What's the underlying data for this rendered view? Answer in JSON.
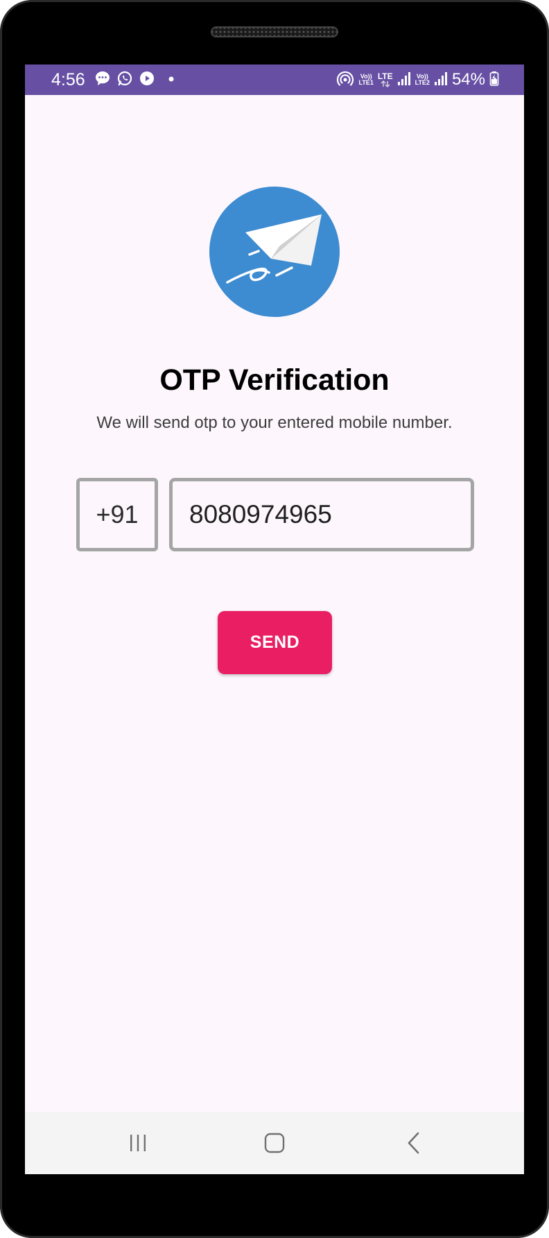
{
  "status_bar": {
    "time": "4:56",
    "battery": "54%",
    "sim1_top": "Vo))",
    "sim1_bottom": "LTE1",
    "lte_label": "LTE",
    "sim2_top": "Vo))",
    "sim2_bottom": "LTE2",
    "left_icons": [
      "chat-icon",
      "whatsapp-icon",
      "youtube-icon",
      "dot-icon"
    ],
    "right_icons": [
      "hotspot-icon",
      "signal-icon",
      "signal-icon",
      "battery-charging-icon"
    ]
  },
  "logo": {
    "icon": "paper-plane-icon",
    "circle_color": "#3d8bd0"
  },
  "page": {
    "title": "OTP Verification",
    "subtitle": "We will send otp to your entered mobile number."
  },
  "form": {
    "country_code": "+91",
    "phone_value": "8080974965",
    "send_label": "SEND"
  },
  "colors": {
    "status_bar": "#6750a4",
    "background": "#fdf7fd",
    "button": "#e91e63",
    "input_border": "#a5a5a5"
  },
  "nav_bar": {
    "icons": [
      "recent-apps-icon",
      "home-icon",
      "back-icon"
    ]
  }
}
